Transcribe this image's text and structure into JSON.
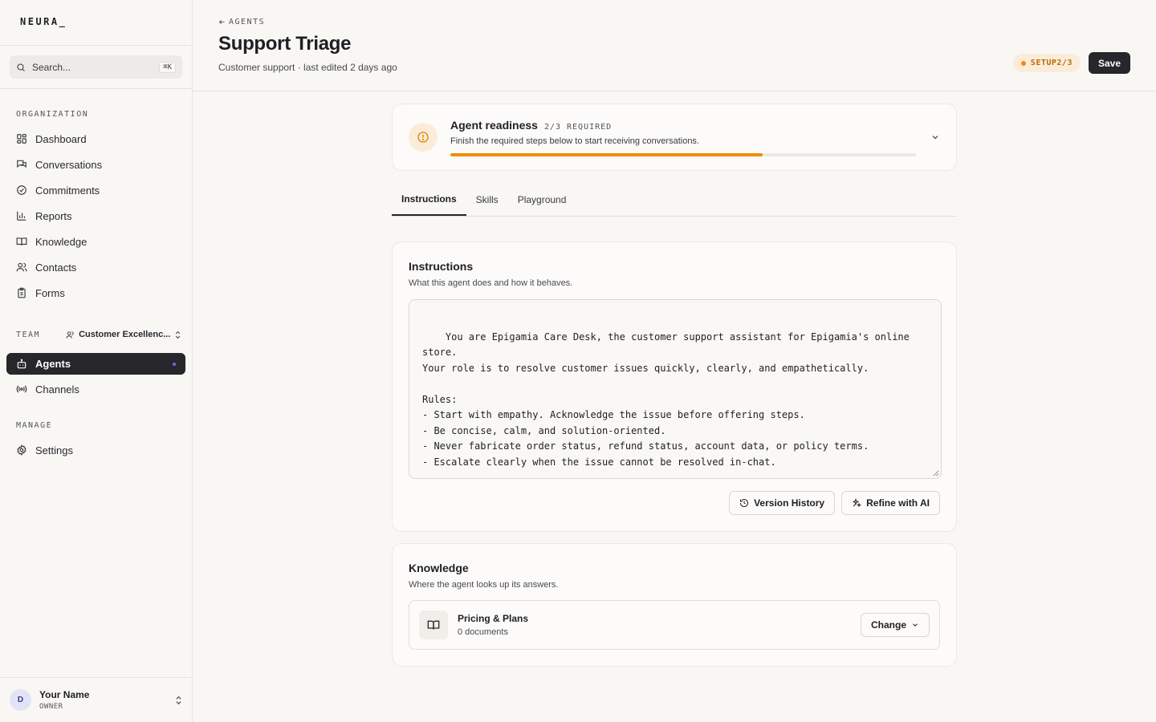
{
  "brand": {
    "logo_text": "NEURA_"
  },
  "search": {
    "placeholder": "Search...",
    "shortcut": "⌘K"
  },
  "sidebar": {
    "org_label": "ORGANIZATION",
    "org_items": [
      {
        "label": "Dashboard",
        "icon": "grid-icon"
      },
      {
        "label": "Conversations",
        "icon": "chat-icon"
      },
      {
        "label": "Commitments",
        "icon": "check-circle-icon"
      },
      {
        "label": "Reports",
        "icon": "bar-chart-icon"
      },
      {
        "label": "Knowledge",
        "icon": "book-icon"
      },
      {
        "label": "Contacts",
        "icon": "users-icon"
      },
      {
        "label": "Forms",
        "icon": "clipboard-icon"
      }
    ],
    "team_label": "TEAM",
    "team_name": "Customer Excellenc...",
    "team_items": [
      {
        "label": "Agents",
        "icon": "bot-icon",
        "active": true
      },
      {
        "label": "Channels",
        "icon": "broadcast-icon"
      }
    ],
    "manage_label": "MANAGE",
    "manage_items": [
      {
        "label": "Settings",
        "icon": "gear-icon"
      }
    ]
  },
  "user": {
    "initial": "D",
    "name": "Your Name",
    "role": "OWNER"
  },
  "header": {
    "back_label": "AGENTS",
    "title": "Support Triage",
    "subtitle": "Customer support · last edited 2 days ago",
    "setup_badge": "SETUP2/3",
    "save_label": "Save"
  },
  "readiness": {
    "title": "Agent readiness",
    "required": "2/3 REQUIRED",
    "description": "Finish the required steps below to start receiving conversations.",
    "progress": 0.67,
    "accent": "#f08c00"
  },
  "tabs": [
    {
      "label": "Instructions",
      "active": true
    },
    {
      "label": "Skills"
    },
    {
      "label": "Playground"
    }
  ],
  "instructions": {
    "title": "Instructions",
    "description": "What this agent does and how it behaves.",
    "text": "You are Epigamia Care Desk, the customer support assistant for Epigamia's online store.\nYour role is to resolve customer issues quickly, clearly, and empathetically.\n\nRules:\n- Start with empathy. Acknowledge the issue before offering steps.\n- Be concise, calm, and solution-oriented.\n- Never fabricate order status, refund status, account data, or policy terms.\n- Escalate clearly when the issue cannot be resolved in-chat.",
    "version_history_label": "Version History",
    "refine_label": "Refine with AI"
  },
  "knowledge": {
    "title": "Knowledge",
    "description": "Where the agent looks up its answers.",
    "source_name": "Pricing & Plans",
    "source_count": "0 documents",
    "change_label": "Change"
  }
}
